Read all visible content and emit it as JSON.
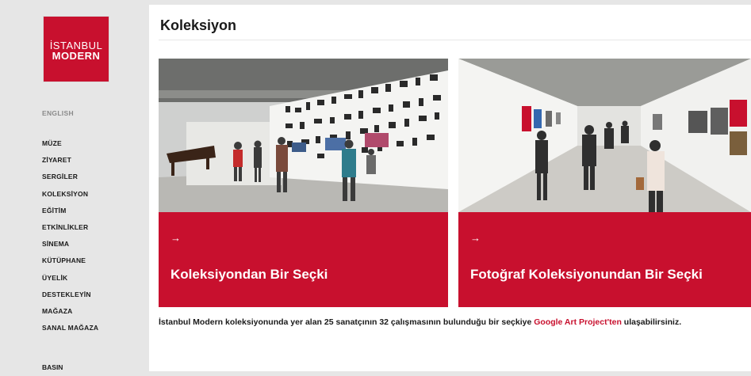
{
  "sidebar": {
    "logo": {
      "line1": "İSTANBUL",
      "line2": "MODERN"
    },
    "language_link": "ENGLISH",
    "nav_items": [
      "MÜZE",
      "ZİYARET",
      "SERGİLER",
      "KOLEKSİYON",
      "EĞİTİM",
      "ETKİNLİKLER",
      "SİNEMA",
      "KÜTÜPHANE",
      "ÜYELİK",
      "DESTEKLEYİN",
      "MAĞAZA",
      "SANAL MAĞAZA"
    ],
    "press_link": "BASIN"
  },
  "main": {
    "title": "Koleksiyon",
    "cards": [
      {
        "arrow": "→",
        "label": "Koleksiyondan Bir Seçki",
        "photo_icon": "gallery-wall-photo"
      },
      {
        "arrow": "→",
        "label": "Fotoğraf Koleksiyonundan Bir Seçki",
        "photo_icon": "gallery-corridor-photo"
      }
    ],
    "description": {
      "text": "İstanbul Modern koleksiyonunda yer alan 25 sanatçının 32 çalışmasının bulunduğu bir seçkiye ",
      "link": "Google Art Project'ten",
      "suffix": " ulaşabilirsiniz."
    }
  },
  "colors": {
    "brand_red": "#c8102e",
    "sidebar_bg": "#e6e6e6",
    "main_bg": "#ffffff"
  }
}
